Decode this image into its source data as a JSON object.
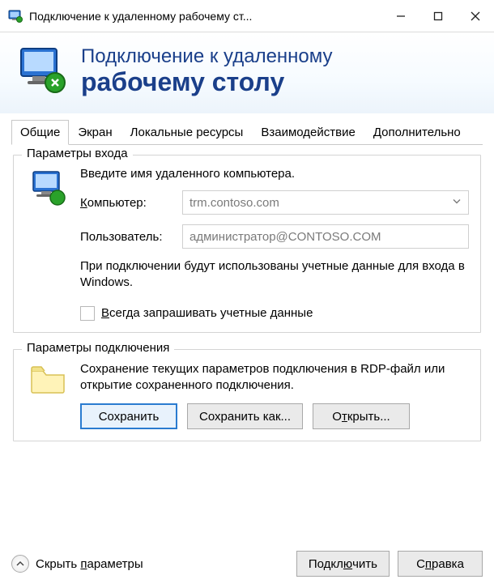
{
  "title": "Подключение к удаленному рабочему ст...",
  "banner": {
    "line1": "Подключение к удаленному",
    "line2": "рабочему столу"
  },
  "tabs": {
    "general": "Общие",
    "display": "Экран",
    "local_resources": "Локальные ресурсы",
    "experience": "Взаимодействие",
    "advanced": "Дополнительно"
  },
  "group_login": {
    "legend": "Параметры входа",
    "intro": "Введите имя удаленного компьютера.",
    "computer_label_pre": "К",
    "computer_label_post": "омпьютер:",
    "computer_value": "trm.contoso.com",
    "user_label": "Пользователь:",
    "user_value": "администратор@CONTOSO.COM",
    "note": "При подключении будут использованы учетные данные для входа в Windows.",
    "always_ask_pre": "В",
    "always_ask_post": "сегда запрашивать учетные данные"
  },
  "group_conn": {
    "legend": "Параметры подключения",
    "text": "Сохранение текущих параметров подключения в RDP-файл или открытие сохраненного подключения.",
    "save": "Сохранить",
    "save_as": "Сохранить как...",
    "open_pre": "О",
    "open_mid": "т",
    "open_post": "крыть..."
  },
  "footer": {
    "collapse_pre": "Скрыть ",
    "collapse_u": "п",
    "collapse_post": "араметры",
    "connect_pre": "Подкл",
    "connect_u": "ю",
    "connect_post": "чить",
    "help_pre": "С",
    "help_u": "п",
    "help_post": "равка"
  }
}
